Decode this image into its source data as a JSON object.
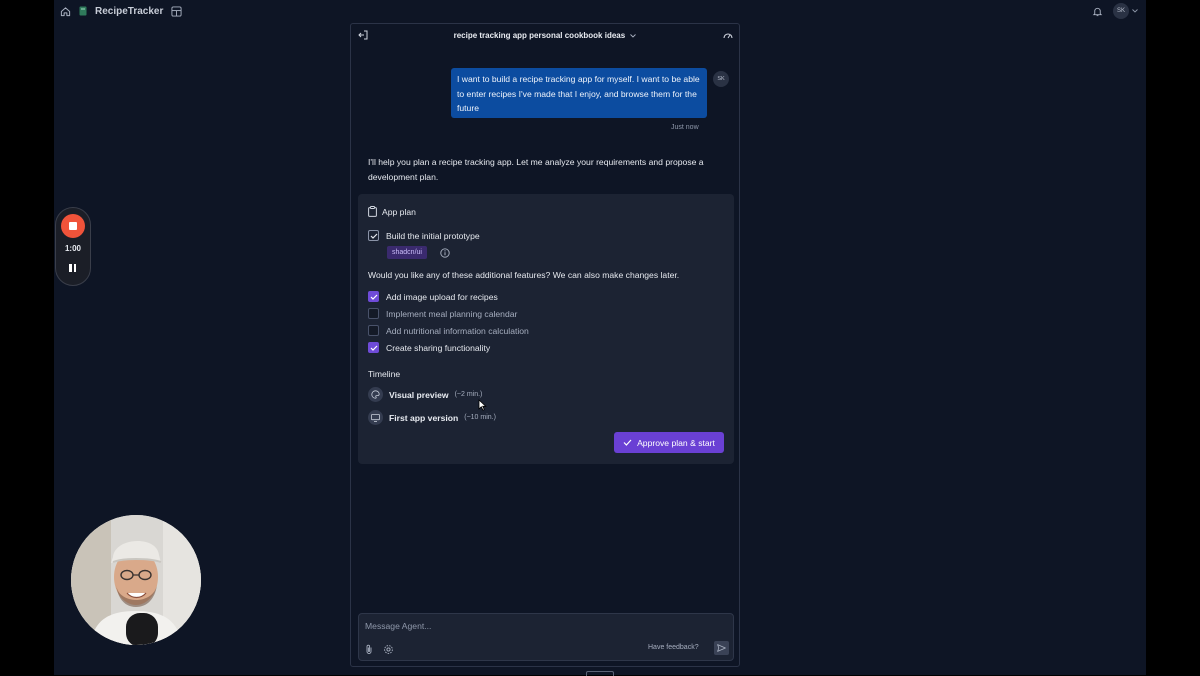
{
  "topbar": {
    "app_title": "RecipeTracker",
    "user_initials": "SK"
  },
  "chat": {
    "title": "recipe tracking app personal cookbook ideas",
    "user_message": "I want to build a recipe tracking app for myself. I want to be able to enter recipes I've made that I enjoy, and browse them for the future",
    "user_initials": "SK",
    "timestamp": "Just now",
    "agent_message": "I'll help you plan a recipe tracking app. Let me analyze your requirements and propose a development plan."
  },
  "plan": {
    "heading": "App plan",
    "base_task": {
      "label": "Build the initial prototype",
      "checked": true
    },
    "tag": "shadcn/ui",
    "question": "Would you like any of these additional features? We can also make changes later.",
    "features": [
      {
        "label": "Add image upload for recipes",
        "checked": true
      },
      {
        "label": "Implement meal planning calendar",
        "checked": false
      },
      {
        "label": "Add nutritional information calculation",
        "checked": false
      },
      {
        "label": "Create sharing functionality",
        "checked": true
      }
    ],
    "timeline_heading": "Timeline",
    "timeline": [
      {
        "label": "Visual preview",
        "time": "(~2 min.)",
        "icon": "palette-icon"
      },
      {
        "label": "First app version",
        "time": "(~10 min.)",
        "icon": "monitor-icon"
      }
    ],
    "approve_label": "Approve plan & start"
  },
  "composer": {
    "placeholder": "Message Agent...",
    "feedback_label": "Have feedback?"
  },
  "recorder": {
    "time": "1:00"
  },
  "colors": {
    "background": "#0e1525",
    "user_bubble": "#0c4ca0",
    "card": "#1c2333",
    "accent": "#6a40d4",
    "record": "#f0533a"
  }
}
